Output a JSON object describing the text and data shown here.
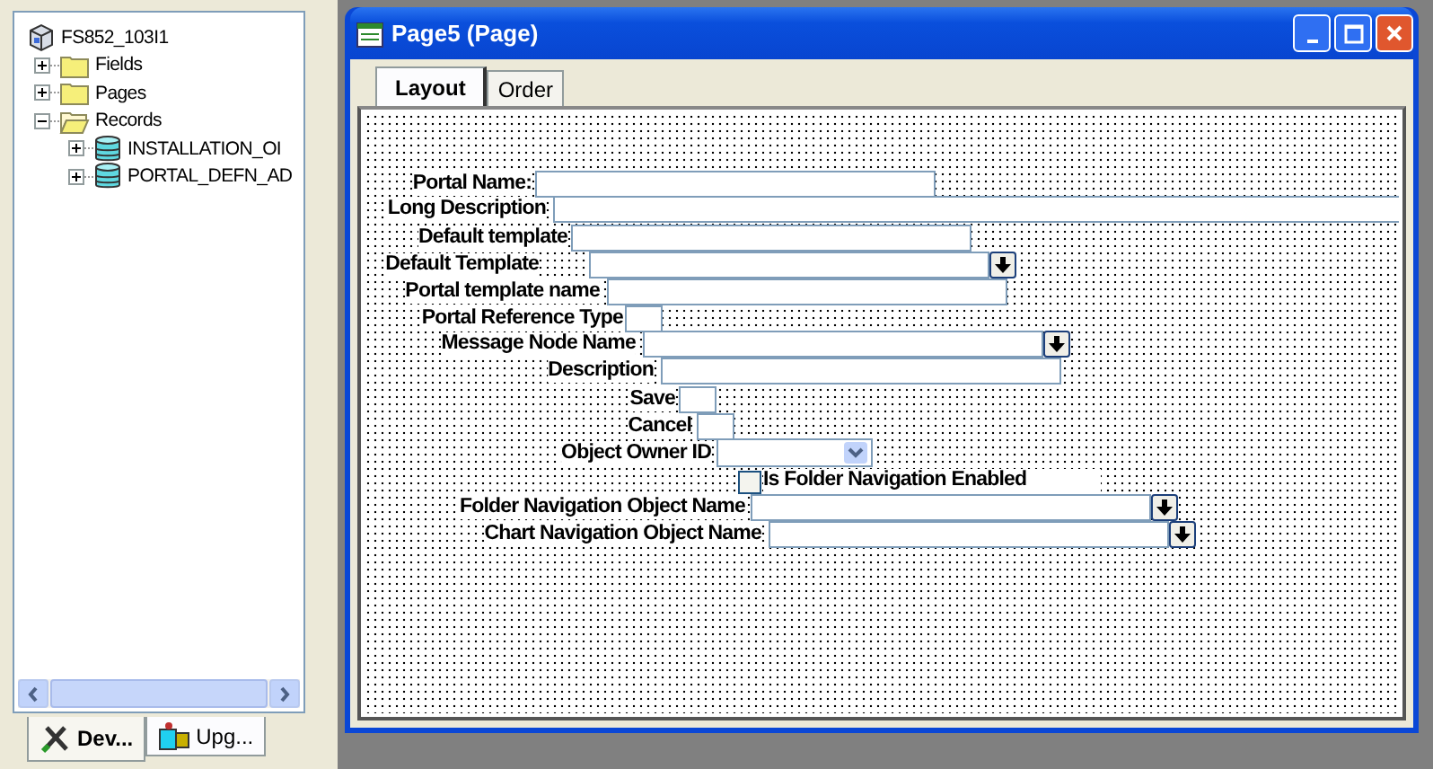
{
  "left_panel": {
    "tree": [
      {
        "label": "FS852_103I1",
        "kind": "project",
        "children": [
          {
            "label": "Fields",
            "kind": "folder",
            "expanded": false
          },
          {
            "label": "Pages",
            "kind": "folder",
            "expanded": false
          },
          {
            "label": "Records",
            "kind": "folder",
            "expanded": true,
            "children": [
              {
                "label": "INSTALLATION_OI",
                "kind": "record",
                "expanded": false
              },
              {
                "label": "PORTAL_DEFN_AD",
                "kind": "record",
                "expanded": false
              }
            ]
          }
        ]
      }
    ],
    "tabs": [
      {
        "label": "Dev...",
        "selected": true
      },
      {
        "label": "Upg...",
        "selected": false
      }
    ]
  },
  "window": {
    "title": "Page5 (Page)",
    "tabs": [
      {
        "label": "Layout",
        "selected": true
      },
      {
        "label": "Order",
        "selected": false
      }
    ],
    "controls": [
      {
        "label": "Portal Name:",
        "kind": "field"
      },
      {
        "label": "Long Description",
        "kind": "field"
      },
      {
        "label": "Default template",
        "kind": "field"
      },
      {
        "label": "Default Template",
        "kind": "dropdown"
      },
      {
        "label": "Portal template name",
        "kind": "field"
      },
      {
        "label": "Portal Reference Type",
        "kind": "field"
      },
      {
        "label": "Message Node Name",
        "kind": "dropdown"
      },
      {
        "label": "Description",
        "kind": "field"
      },
      {
        "label": "Save",
        "kind": "field"
      },
      {
        "label": "Cancel",
        "kind": "field"
      },
      {
        "label": "Object Owner ID",
        "kind": "combo"
      },
      {
        "label": "Is Folder Navigation Enabled",
        "kind": "checkbox",
        "checked": false
      },
      {
        "label": "Folder Navigation Object Name",
        "kind": "dropdown"
      },
      {
        "label": "Chart Navigation Object Name",
        "kind": "dropdown"
      }
    ]
  }
}
